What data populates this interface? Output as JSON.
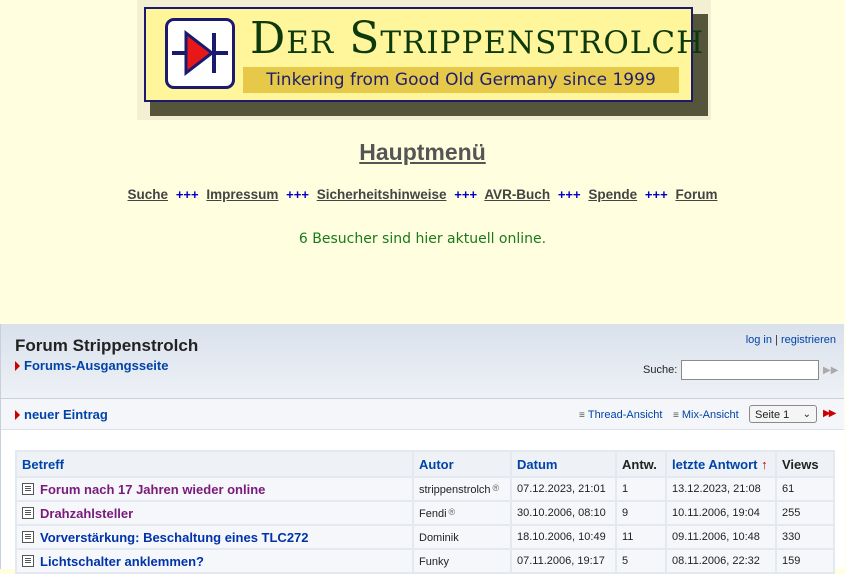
{
  "banner": {
    "title": "Der Strippenstrolch",
    "subtitle": "Tinkering from Good Old Germany since 1999"
  },
  "main_heading": "Hauptmenü",
  "top_nav": {
    "items": [
      "Suche",
      "Impressum",
      "Sicherheitshinweise",
      "AVR-Buch",
      "Spende",
      "Forum"
    ],
    "separator": "+++"
  },
  "visitors_text": "6 Besucher sind hier aktuell online.",
  "forum": {
    "title": "Forum Strippenstrolch",
    "home_link": "Forums-Ausgangsseite",
    "login": "log in",
    "login_sep": "|",
    "register": "registrieren",
    "search_label": "Suche:",
    "search_value": "",
    "new_entry": "neuer Eintrag",
    "thread_view": "Thread-Ansicht",
    "mix_view": "Mix-Ansicht",
    "page_select": "Seite 1"
  },
  "table": {
    "headers": [
      "Betreff",
      "Autor",
      "Datum",
      "Antw.",
      "letzte Antwort",
      "Views"
    ],
    "sort_indicator": "↑",
    "rows": [
      {
        "subject": "Forum nach 17 Jahren wieder online",
        "author": "strippenstrolch",
        "registered": "®",
        "date": "07.12.2023, 21:01",
        "replies": "1",
        "last": "13.12.2023, 21:08",
        "views": "61"
      },
      {
        "subject": "Drahzahlsteller",
        "author": "Fendi",
        "registered": "®",
        "date": "30.10.2006, 08:10",
        "replies": "9",
        "last": "10.11.2006, 19:04",
        "views": "255"
      },
      {
        "subject": "Vorverstärkung: Beschaltung eines TLC272",
        "author": "Dominik",
        "registered": "",
        "date": "18.10.2006, 10:49",
        "replies": "11",
        "last": "09.11.2006, 10:48",
        "views": "330"
      },
      {
        "subject": "Lichtschalter anklemmen?",
        "author": "Funky",
        "registered": "",
        "date": "07.11.2006, 19:17",
        "replies": "5",
        "last": "08.11.2006, 22:32",
        "views": "159"
      }
    ]
  },
  "colors": {
    "page_bg": "#ffffe0",
    "link_blue": "#0044aa",
    "accent_red": "#cc0000",
    "visitor_green": "#1a7a1a"
  }
}
